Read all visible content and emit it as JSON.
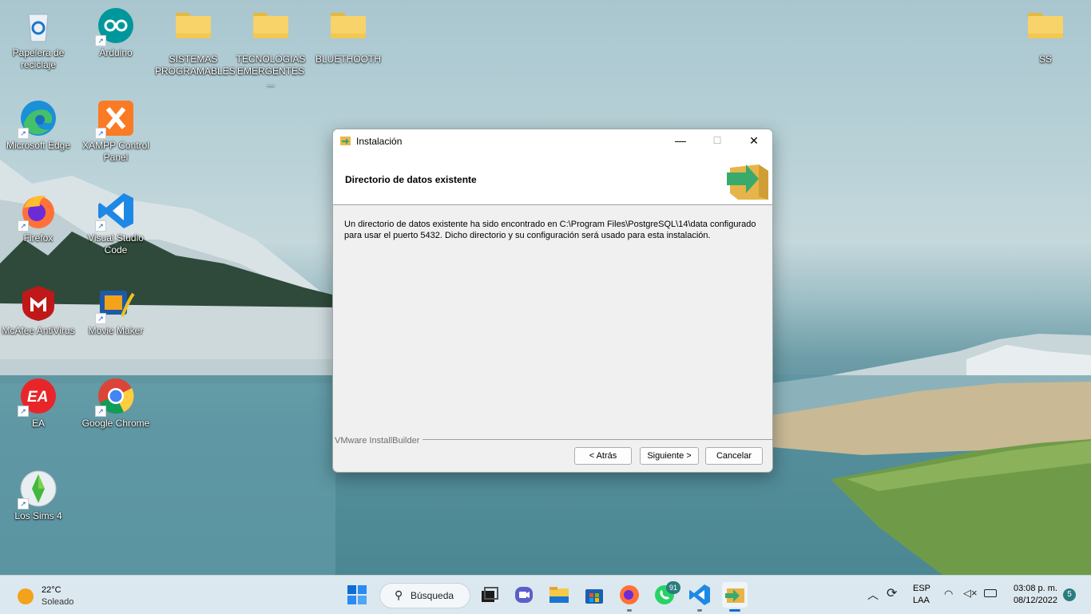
{
  "desktop": {
    "icons": [
      {
        "label": "Papelera de reciclaje",
        "line1": "Papelera de",
        "line2": "reciclaje"
      },
      {
        "label": "Arduino"
      },
      {
        "label": "SISTEMAS PROGRAMABLES",
        "line1": "SISTEMAS",
        "line2": "PROGRAMABLES"
      },
      {
        "label": "TECNOLOGIAS EMERGENTES ...",
        "line1": "TECNOLOGIAS",
        "line2": "EMERGENTES ..."
      },
      {
        "label": "BLUETHOOTH"
      },
      {
        "label": "SS"
      },
      {
        "label": "Microsoft Edge"
      },
      {
        "label": "XAMPP Control Panel",
        "line1": "XAMPP Control",
        "line2": "Panel"
      },
      {
        "label": "Firefox"
      },
      {
        "label": "Visual Studio Code",
        "line1": "Visual Studio",
        "line2": "Code"
      },
      {
        "label": "McAfee AntiVirus"
      },
      {
        "label": "Movie Maker"
      },
      {
        "label": "EA"
      },
      {
        "label": "Google Chrome"
      },
      {
        "label": "Los Sims 4"
      }
    ]
  },
  "dialog": {
    "title": "Instalación",
    "header_title": "Directorio de datos existente",
    "body_text": "Un directorio de datos existente ha sido encontrado en C:\\Program Files\\PostgreSQL\\14\\data configurado para usar el puerto 5432. Dicho directorio y su configuración será usado para esta instalación.",
    "brand": "VMware InstallBuilder",
    "buttons": {
      "back": "< Atrás",
      "next": "Siguiente >",
      "cancel": "Cancelar"
    },
    "window_controls": {
      "minimize": "—",
      "maximize": "☐",
      "close": "✕"
    }
  },
  "taskbar": {
    "weather": {
      "temp": "22°C",
      "condition": "Soleado"
    },
    "search_label": "Búsqueda",
    "whatsapp_badge": "91",
    "tray": {
      "lang1": "ESP",
      "lang2": "LAA",
      "time": "03:08 p. m.",
      "date": "08/12/2022",
      "notifications": "5"
    },
    "colors": {
      "accent": "#0078d4",
      "badge": "#2b7d7d"
    }
  }
}
